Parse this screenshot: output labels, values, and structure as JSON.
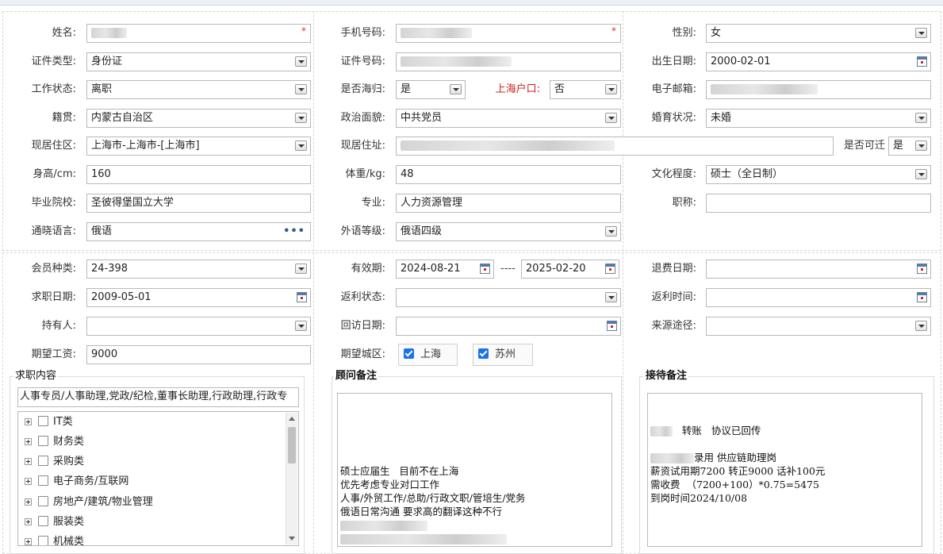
{
  "form": {
    "name_label": "姓名:",
    "phone_label": "手机号码:",
    "gender_label": "性别:",
    "gender_value": "女",
    "id_type_label": "证件类型:",
    "id_type_value": "身份证",
    "id_no_label": "证件号码:",
    "birth_label": "出生日期:",
    "birth_value": "2000-02-01",
    "work_status_label": "工作状态:",
    "work_status_value": "离职",
    "returnee_label": "是否海归:",
    "returnee_value": "是",
    "shanghai_hukou_label": "上海户口:",
    "shanghai_hukou_value": "否",
    "email_label": "电子邮箱:",
    "native_label": "籍贯:",
    "native_value": "内蒙古自治区",
    "political_label": "政治面貌:",
    "political_value": "中共党员",
    "marital_label": "婚育状况:",
    "marital_value": "未婚",
    "residence_area_label": "现居住区:",
    "residence_area_value": " 上海市-上海市-[上海市]",
    "address_label": "现居住址:",
    "relocate_label": "是否可迁",
    "relocate_value": "是",
    "height_label": "身高/cm:",
    "height_value": "160",
    "weight_label": "体重/kg:",
    "weight_value": "48",
    "education_label": "文化程度:",
    "education_value": "硕士（全日制）",
    "school_label": "毕业院校:",
    "school_value": "圣彼得堡国立大学",
    "major_label": "专业:",
    "major_value": "人力资源管理",
    "title_label": "职称:",
    "title_value": "",
    "language_label": "通晓语言:",
    "language_value": "俄语",
    "language_more": "•••",
    "language_level_label": "外语等级:",
    "language_level_value": "俄语四级",
    "member_type_label": "会员种类:",
    "member_type_value": " 24-398",
    "valid_label": "有效期:",
    "valid_from": "2024-08-21",
    "valid_sep": "----",
    "valid_to": "2025-02-20",
    "refund_date_label": "退费日期:",
    "job_date_label": "求职日期:",
    "job_date_value": "2009-05-01",
    "rebate_status_label": "返利状态:",
    "rebate_time_label": "返利时间:",
    "holder_label": "持有人:",
    "revisit_label": "回访日期:",
    "source_label": "来源途径:",
    "salary_label": "期望工资:",
    "salary_value": "9000",
    "city_label": "期望城区:",
    "city_1": "上海",
    "city_2": "苏州"
  },
  "job_content": {
    "legend": "求职内容",
    "selected_text": "人事专员/人事助理,党政/纪检,董事长助理,行政助理,行政专",
    "tree": [
      "IT类",
      "财务类",
      "采购类",
      "电子商务/互联网",
      "房地产/建筑/物业管理",
      "服装类",
      "机械类"
    ]
  },
  "advisor_note": {
    "legend": "顾问备注",
    "lines": [
      "",
      "",
      "",
      "硕士应届生   目前不在上海",
      "优先考虑专业对口工作",
      "人事/外贸工作/总助/行政文职/管培生/党务",
      "俄语日常沟通 要求高的翻译这种不行"
    ]
  },
  "reception_note": {
    "legend": "接待备注",
    "line1_suffix": "   转账   协议已回传",
    "line2": "",
    "line3_suffix": "录用 供应链助理岗",
    "line4": "薪资试用期7200 转正9000 话补100元",
    "line5": "需收费  （7200+100）*0.75=5475",
    "line6": "到岗时间2024/10/08"
  },
  "colors": {
    "required": "#e0302c",
    "hukou_label": "#d0201f",
    "checkbox": "#1a73e8"
  }
}
